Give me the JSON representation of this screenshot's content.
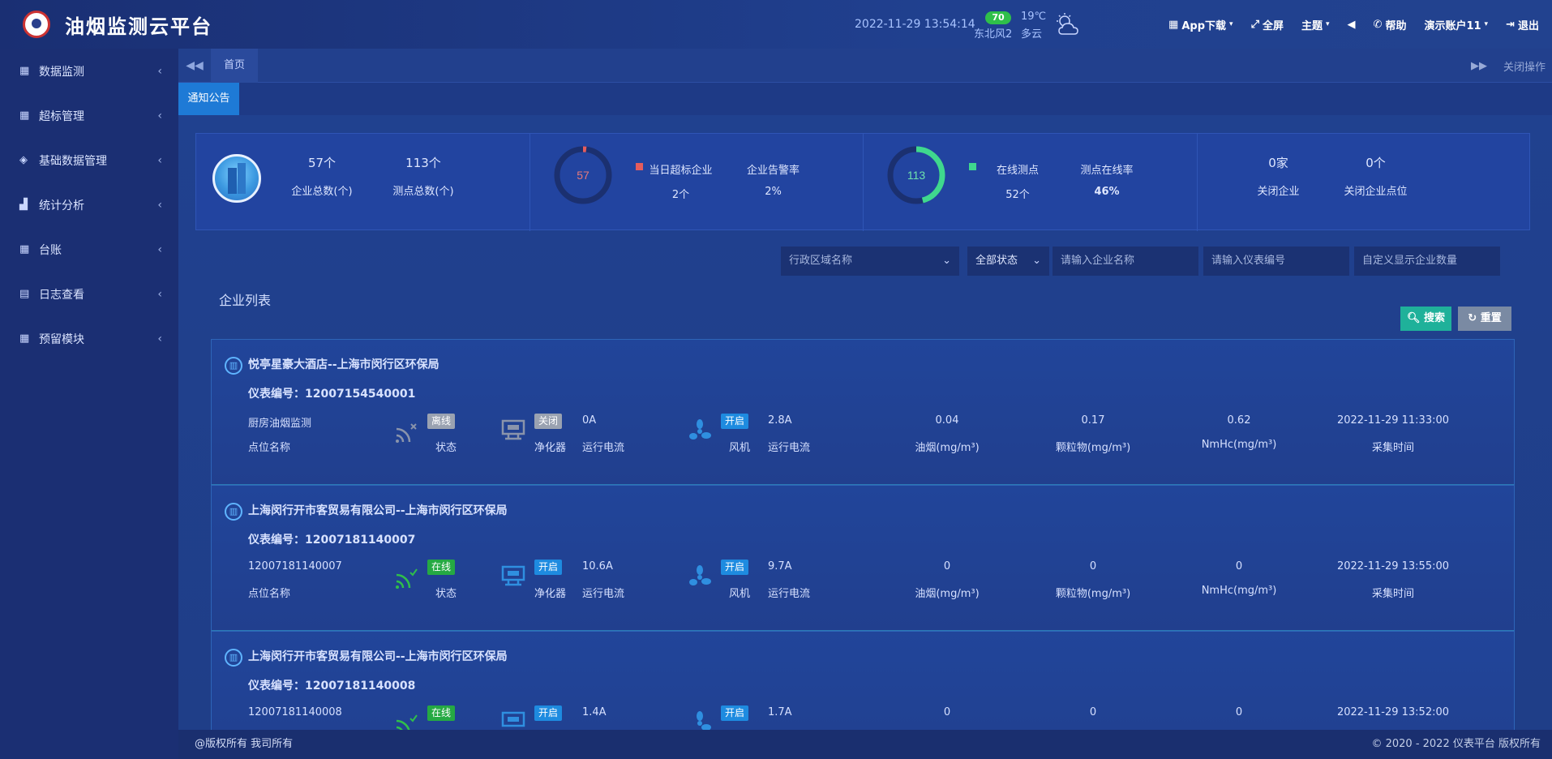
{
  "header": {
    "app_title": "油烟监测云平台",
    "datetime": "2022-11-29  13:54:14",
    "aqi": "70",
    "wind": "东北风2",
    "temperature": "19℃",
    "condition": "多云",
    "menu": [
      {
        "label": "App下载",
        "icon": "qrcode-icon"
      },
      {
        "label": "全屏",
        "icon": "fullscreen-icon"
      },
      {
        "label": "主题",
        "icon": "theme-icon"
      },
      {
        "label": "",
        "icon": "volume-icon"
      },
      {
        "label": "帮助",
        "icon": "phone-icon"
      },
      {
        "label": "演示账户11",
        "icon": "user-icon"
      },
      {
        "label": "退出",
        "icon": "logout-icon"
      }
    ]
  },
  "sidebar": {
    "items": [
      {
        "label": "数据监测"
      },
      {
        "label": "超标管理"
      },
      {
        "label": "基础数据管理"
      },
      {
        "label": "统计分析"
      },
      {
        "label": "台账"
      },
      {
        "label": "日志查看"
      },
      {
        "label": "预留模块"
      }
    ]
  },
  "tabs": {
    "home": "首页",
    "close_ops": "关闭操作",
    "notice": "通知公告"
  },
  "stats": {
    "enterprise_total_value": "57个",
    "enterprise_total_label": "企业总数(个)",
    "point_total_value": "113个",
    "point_total_label": "测点总数(个)",
    "donut1_value": "57",
    "overstd_label": "当日超标企业",
    "overstd_value": "2个",
    "alarm_rate_label": "企业告警率",
    "alarm_rate_value": "2%",
    "donut2_value": "113",
    "online_label": "在线测点",
    "online_value": "52个",
    "online_rate_label": "测点在线率",
    "online_rate_value": "46%",
    "closed_ent_value": "0家",
    "closed_ent_label": "关闭企业",
    "closed_point_value": "0个",
    "closed_point_label": "关闭企业点位",
    "alarm_fraction": 0.02,
    "online_fraction": 0.46,
    "colors": {
      "alarm": "#e55c5c",
      "online": "#3fd88e",
      "ring": "#1b3070"
    }
  },
  "filters": {
    "region_placeholder": "行政区域名称",
    "status_value": "全部状态",
    "company_placeholder": "请输入企业名称",
    "meter_placeholder": "请输入仪表编号",
    "count_placeholder": "自定义显示企业数量"
  },
  "list": {
    "title": "企业列表",
    "search_btn": "搜索",
    "reset_btn": "重置"
  },
  "cards": [
    {
      "title": "悦亭星豪大酒店--上海市闵行区环保局",
      "meter": "仪表编号：12007154540001",
      "point": "厨房油烟监测",
      "status": "离线",
      "purifier": "关闭",
      "purifier_current": "0A",
      "fan": "开启",
      "fan_current": "2.8A",
      "oil": "0.04",
      "particle": "0.17",
      "nmhc": "0.62",
      "time": "2022-11-29 11:33:00"
    },
    {
      "title": "上海闵行开市客贸易有限公司--上海市闵行区环保局",
      "meter": "仪表编号：12007181140007",
      "point": "12007181140007",
      "status": "在线",
      "purifier": "开启",
      "purifier_current": "10.6A",
      "fan": "开启",
      "fan_current": "9.7A",
      "oil": "0",
      "particle": "0",
      "nmhc": "0",
      "time": "2022-11-29 13:55:00"
    },
    {
      "title": "上海闵行开市客贸易有限公司--上海市闵行区环保局",
      "meter": "仪表编号：12007181140008",
      "point": "12007181140008",
      "status": "在线",
      "purifier": "开启",
      "purifier_current": "1.4A",
      "fan": "开启",
      "fan_current": "1.7A",
      "oil": "0",
      "particle": "0",
      "nmhc": "0",
      "time": "2022-11-29 13:52:00"
    }
  ],
  "card_labels": {
    "point_name": "点位名称",
    "status": "状态",
    "purifier": "净化器",
    "run_current": "运行电流",
    "fan": "风机",
    "oil": "油烟(mg/m³)",
    "particle": "颗粒物(mg/m³)",
    "nmhc": "NmHc(mg/m³)",
    "collect_time": "采集时间"
  },
  "footer": {
    "left": "@版权所有 我司所有",
    "right": "© 2020 - 2022 仪表平台 版权所有"
  }
}
